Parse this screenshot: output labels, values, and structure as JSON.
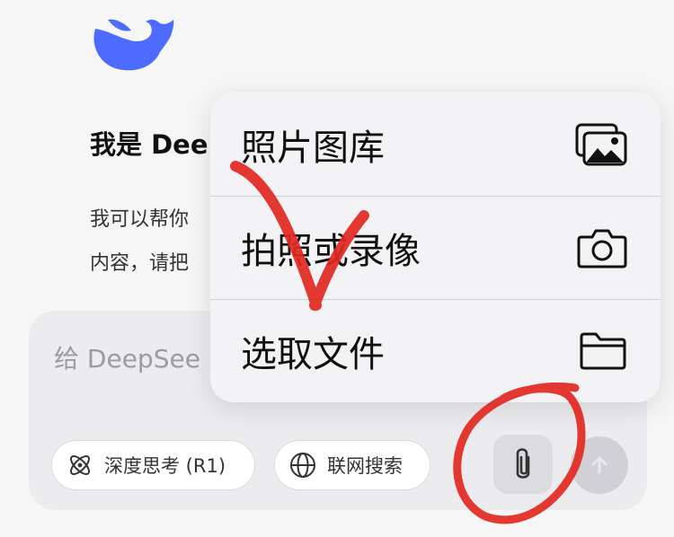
{
  "welcome": {
    "title": "我是 Dee",
    "lines": [
      "我可以帮你",
      "内容，请把"
    ]
  },
  "composer": {
    "placeholder": "给 DeepSee",
    "chips": {
      "think": "深度思考 (R1)",
      "search": "联网搜索"
    }
  },
  "attach_menu": {
    "items": [
      {
        "label": "照片图库",
        "icon": "photo-library-icon"
      },
      {
        "label": "拍照或录像",
        "icon": "camera-icon"
      },
      {
        "label": "选取文件",
        "icon": "folder-icon"
      }
    ]
  },
  "colors": {
    "brand": "#4d6bfe",
    "annotation": "#e2281f"
  }
}
